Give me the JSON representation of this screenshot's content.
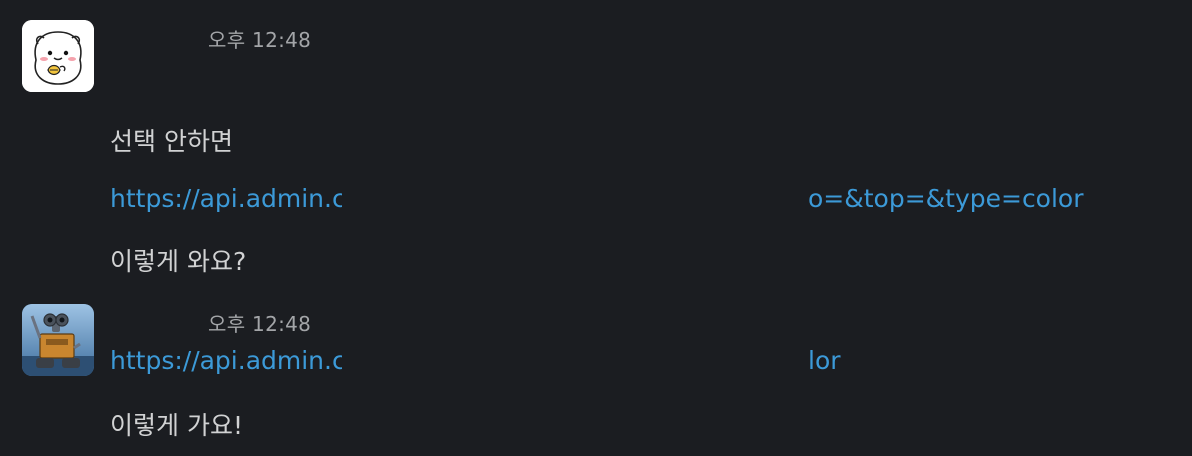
{
  "messages": [
    {
      "avatar_icon": "bear-character-icon",
      "timestamp": "오후 12:48",
      "lines": [
        {
          "type": "text",
          "value": "선택 안하면"
        },
        {
          "type": "link",
          "prefix": "https://api.admin.c",
          "suffix": "o=&top=&type=color"
        },
        {
          "type": "text",
          "value": "이렇게 와요?"
        }
      ]
    },
    {
      "avatar_icon": "robot-character-icon",
      "timestamp": "오후 12:48",
      "lines": [
        {
          "type": "link",
          "prefix": "https://api.admin.c",
          "suffix": "lor"
        },
        {
          "type": "text",
          "value": "이렇게 가요!"
        }
      ]
    }
  ]
}
